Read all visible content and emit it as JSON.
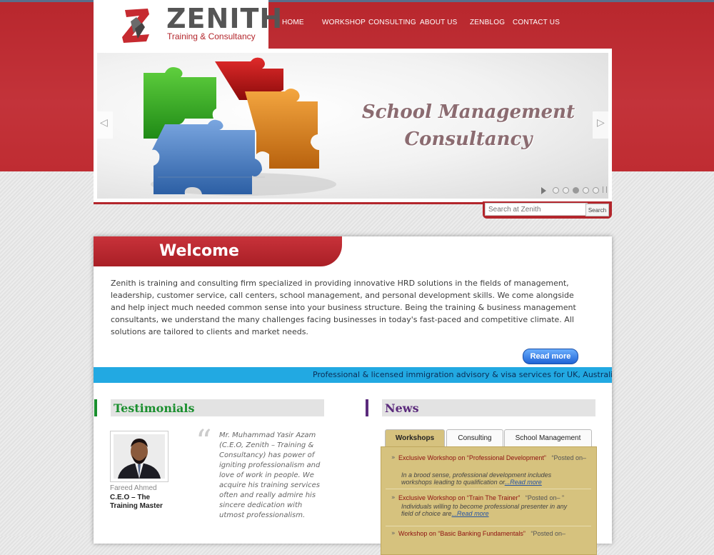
{
  "brand": {
    "name": "ZENITH",
    "tagline": "Training & Consultancy"
  },
  "nav": [
    {
      "label": "HOME"
    },
    {
      "label": "WORKSHOP"
    },
    {
      "label": "CONSULTING"
    },
    {
      "label": "ABOUT US"
    },
    {
      "label": "ZENBLOG"
    },
    {
      "label": "CONTACT US"
    }
  ],
  "banner": {
    "line1": "School Management",
    "line2": "Consultancy",
    "slides": 5,
    "active_slide": 3
  },
  "search": {
    "placeholder": "Search at Zenith",
    "button": "Search"
  },
  "welcome": {
    "title": "Welcome",
    "text": "Zenith is training and consulting firm specialized in providing innovative HRD solutions in the fields of management, leadership, customer service, call centers, school management, and personal development skills. We come alongside and help inject much needed common sense into your business structure. Being the training & business management consultants, we understand the many challenges facing businesses in today's fast-paced and competitive climate. All solutions are tailored to clients and market needs.",
    "read_more": "Read more"
  },
  "ticker": "Professional & licensed immigration advisory & visa services for UK, Australia & Can",
  "testimonials": {
    "title": "Testimonials",
    "person_name": "Fareed Ahmed",
    "person_role": "C.E.O – The Training Master",
    "quote": "Mr. Muhammad Yasir Azam (C.E.O, Zenith – Training & Consultancy) has power of igniting professionalism and love of work in people. We acquire his training services often and really admire his sincere dedication with utmost professionalism."
  },
  "news": {
    "title": "News",
    "tabs": [
      {
        "label": "Workshops"
      },
      {
        "label": "Consulting"
      },
      {
        "label": "School Management"
      }
    ],
    "items": [
      {
        "title": "Exclusive Workshop on “Professional Development”",
        "posted": "“Posted on–",
        "desc": "In a brood sense, professional development includes workshops leading to qualification or",
        "more": "...Read more"
      },
      {
        "title": "Exclusive Workshop on “Train The Trainer”",
        "posted": "“Posted on– ”",
        "desc": "Individuals willing to become professional presenter in any field of choice are",
        "more": "...Read more"
      },
      {
        "title": "Workshop on “Basic Banking Fundamentals”",
        "posted": "“Posted on–",
        "desc": "",
        "more": ""
      }
    ]
  },
  "colors": {
    "brand_red": "#b3262c",
    "ticker_blue": "#22a9e2",
    "news_gold": "#d6c27e",
    "testimonials_green": "#1a8f2e",
    "news_purple": "#5b2b7c"
  }
}
